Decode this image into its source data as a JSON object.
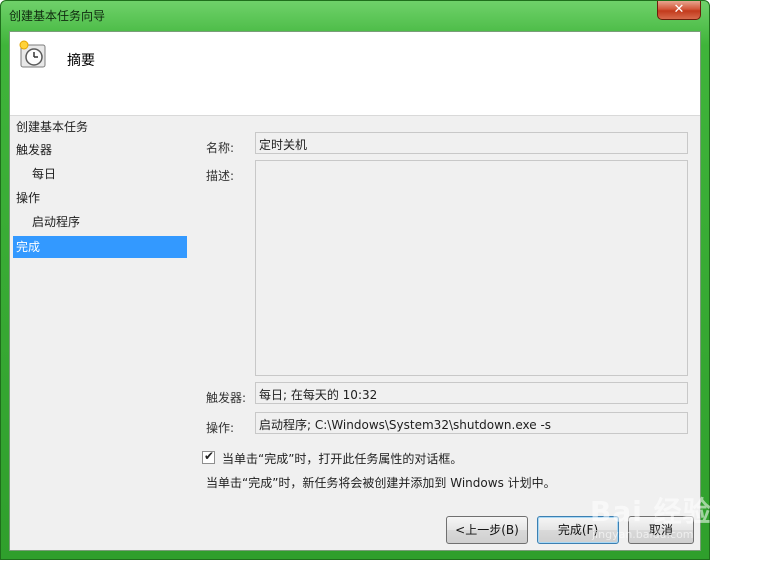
{
  "window": {
    "title": "创建基本任务向导",
    "close_label": "✕"
  },
  "header": {
    "title": "摘要",
    "icon": "task-clock-icon"
  },
  "steps": [
    {
      "label": "创建基本任务",
      "sub": false,
      "active": false
    },
    {
      "label": "触发器",
      "sub": false,
      "active": false
    },
    {
      "label": "每日",
      "sub": true,
      "active": false
    },
    {
      "label": "操作",
      "sub": false,
      "active": false
    },
    {
      "label": "启动程序",
      "sub": true,
      "active": false
    },
    {
      "label": "完成",
      "sub": false,
      "active": true
    }
  ],
  "summary": {
    "name_label": "名称:",
    "name_value": "定时关机",
    "desc_label": "描述:",
    "desc_value": "",
    "trigger_label": "触发器:",
    "trigger_value": "每日; 在每天的 10:32",
    "action_label": "操作:",
    "action_value": "启动程序; C:\\Windows\\System32\\shutdown.exe -s"
  },
  "checkbox": {
    "checked": true,
    "label": "当单击“完成”时，打开此任务属性的对话框。"
  },
  "info_text": "当单击“完成”时，新任务将会被创建并添加到 Windows 计划中。",
  "buttons": {
    "back": "<上一步(B)",
    "finish": "完成(F)",
    "cancel": "取消"
  },
  "watermark": {
    "main": "Bai 经验",
    "sub": "jingyan.baidu.com"
  },
  "colors": {
    "accent": "#3399ff",
    "frame": "#3fb43a"
  }
}
